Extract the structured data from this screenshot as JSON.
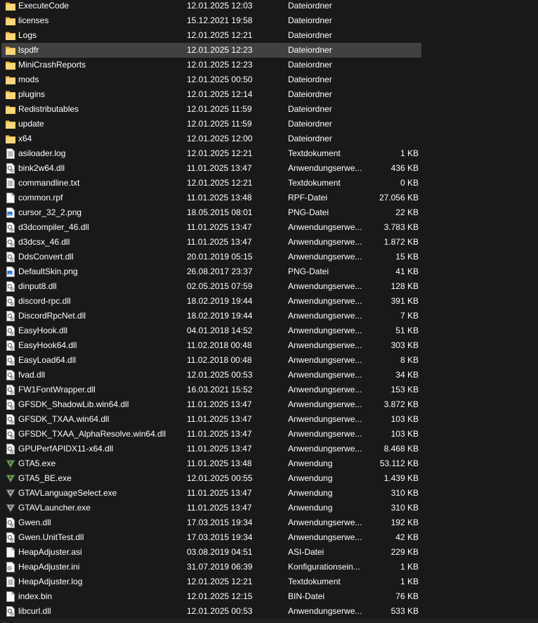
{
  "files": [
    {
      "name": "ExecuteCode",
      "date": "12.01.2025 12:03",
      "type": "Dateiordner",
      "size": "",
      "icon": "folder-icon"
    },
    {
      "name": "licenses",
      "date": "15.12.2021 19:58",
      "type": "Dateiordner",
      "size": "",
      "icon": "folder-icon"
    },
    {
      "name": "Logs",
      "date": "12.01.2025 12:21",
      "type": "Dateiordner",
      "size": "",
      "icon": "folder-icon"
    },
    {
      "name": "lspdfr",
      "date": "12.01.2025 12:23",
      "type": "Dateiordner",
      "size": "",
      "icon": "folder-icon",
      "selected": true
    },
    {
      "name": "MiniCrashReports",
      "date": "12.01.2025 12:23",
      "type": "Dateiordner",
      "size": "",
      "icon": "folder-icon"
    },
    {
      "name": "mods",
      "date": "12.01.2025 00:50",
      "type": "Dateiordner",
      "size": "",
      "icon": "folder-icon"
    },
    {
      "name": "plugins",
      "date": "12.01.2025 12:14",
      "type": "Dateiordner",
      "size": "",
      "icon": "folder-icon"
    },
    {
      "name": "Redistributables",
      "date": "12.01.2025 11:59",
      "type": "Dateiordner",
      "size": "",
      "icon": "folder-icon"
    },
    {
      "name": "update",
      "date": "12.01.2025 11:59",
      "type": "Dateiordner",
      "size": "",
      "icon": "folder-icon"
    },
    {
      "name": "x64",
      "date": "12.01.2025 12:00",
      "type": "Dateiordner",
      "size": "",
      "icon": "folder-icon"
    },
    {
      "name": "asiloader.log",
      "date": "12.01.2025 12:21",
      "type": "Textdokument",
      "size": "1 KB",
      "icon": "text-file-icon"
    },
    {
      "name": "bink2w64.dll",
      "date": "11.01.2025 13:47",
      "type": "Anwendungserwe...",
      "size": "436 KB",
      "icon": "dll-file-icon"
    },
    {
      "name": "commandline.txt",
      "date": "12.01.2025 12:21",
      "type": "Textdokument",
      "size": "0 KB",
      "icon": "text-file-icon"
    },
    {
      "name": "common.rpf",
      "date": "11.01.2025 13:48",
      "type": "RPF-Datei",
      "size": "27.056 KB",
      "icon": "blank-file-icon"
    },
    {
      "name": "cursor_32_2.png",
      "date": "18.05.2015 08:01",
      "type": "PNG-Datei",
      "size": "22 KB",
      "icon": "image-file-icon"
    },
    {
      "name": "d3dcompiler_46.dll",
      "date": "11.01.2025 13:47",
      "type": "Anwendungserwe...",
      "size": "3.783 KB",
      "icon": "dll-file-icon"
    },
    {
      "name": "d3dcsx_46.dll",
      "date": "11.01.2025 13:47",
      "type": "Anwendungserwe...",
      "size": "1.872 KB",
      "icon": "dll-file-icon"
    },
    {
      "name": "DdsConvert.dll",
      "date": "20.01.2019 05:15",
      "type": "Anwendungserwe...",
      "size": "15 KB",
      "icon": "dll-file-icon"
    },
    {
      "name": "DefaultSkin.png",
      "date": "26.08.2017 23:37",
      "type": "PNG-Datei",
      "size": "41 KB",
      "icon": "image-file-icon"
    },
    {
      "name": "dinput8.dll",
      "date": "02.05.2015 07:59",
      "type": "Anwendungserwe...",
      "size": "128 KB",
      "icon": "dll-file-icon"
    },
    {
      "name": "discord-rpc.dll",
      "date": "18.02.2019 19:44",
      "type": "Anwendungserwe...",
      "size": "391 KB",
      "icon": "dll-file-icon"
    },
    {
      "name": "DiscordRpcNet.dll",
      "date": "18.02.2019 19:44",
      "type": "Anwendungserwe...",
      "size": "7 KB",
      "icon": "dll-file-icon"
    },
    {
      "name": "EasyHook.dll",
      "date": "04.01.2018 14:52",
      "type": "Anwendungserwe...",
      "size": "51 KB",
      "icon": "dll-file-icon"
    },
    {
      "name": "EasyHook64.dll",
      "date": "11.02.2018 00:48",
      "type": "Anwendungserwe...",
      "size": "303 KB",
      "icon": "dll-file-icon"
    },
    {
      "name": "EasyLoad64.dll",
      "date": "11.02.2018 00:48",
      "type": "Anwendungserwe...",
      "size": "8 KB",
      "icon": "dll-file-icon"
    },
    {
      "name": "fvad.dll",
      "date": "12.01.2025 00:53",
      "type": "Anwendungserwe...",
      "size": "34 KB",
      "icon": "dll-file-icon"
    },
    {
      "name": "FW1FontWrapper.dll",
      "date": "16.03.2021 15:52",
      "type": "Anwendungserwe...",
      "size": "153 KB",
      "icon": "dll-file-icon"
    },
    {
      "name": "GFSDK_ShadowLib.win64.dll",
      "date": "11.01.2025 13:47",
      "type": "Anwendungserwe...",
      "size": "3.872 KB",
      "icon": "dll-file-icon"
    },
    {
      "name": "GFSDK_TXAA.win64.dll",
      "date": "11.01.2025 13:47",
      "type": "Anwendungserwe...",
      "size": "103 KB",
      "icon": "dll-file-icon"
    },
    {
      "name": "GFSDK_TXAA_AlphaResolve.win64.dll",
      "date": "11.01.2025 13:47",
      "type": "Anwendungserwe...",
      "size": "103 KB",
      "icon": "dll-file-icon"
    },
    {
      "name": "GPUPerfAPIDX11-x64.dll",
      "date": "11.01.2025 13:47",
      "type": "Anwendungserwe...",
      "size": "8.468 KB",
      "icon": "dll-file-icon"
    },
    {
      "name": "GTA5.exe",
      "date": "11.01.2025 13:48",
      "type": "Anwendung",
      "size": "53.112 KB",
      "icon": "gta-v-logo-icon"
    },
    {
      "name": "GTA5_BE.exe",
      "date": "12.01.2025 00:55",
      "type": "Anwendung",
      "size": "1.439 KB",
      "icon": "gta-v-logo-icon"
    },
    {
      "name": "GTAVLanguageSelect.exe",
      "date": "11.01.2025 13:47",
      "type": "Anwendung",
      "size": "310 KB",
      "icon": "gta-v-gray-logo-icon"
    },
    {
      "name": "GTAVLauncher.exe",
      "date": "11.01.2025 13:47",
      "type": "Anwendung",
      "size": "310 KB",
      "icon": "gta-v-gray-logo-icon"
    },
    {
      "name": "Gwen.dll",
      "date": "17.03.2015 19:34",
      "type": "Anwendungserwe...",
      "size": "192 KB",
      "icon": "dll-file-icon"
    },
    {
      "name": "Gwen.UnitTest.dll",
      "date": "17.03.2015 19:34",
      "type": "Anwendungserwe...",
      "size": "42 KB",
      "icon": "dll-file-icon"
    },
    {
      "name": "HeapAdjuster.asi",
      "date": "03.08.2019 04:51",
      "type": "ASI-Datei",
      "size": "229 KB",
      "icon": "blank-file-icon"
    },
    {
      "name": "HeapAdjuster.ini",
      "date": "31.07.2019 06:39",
      "type": "Konfigurationsein...",
      "size": "1 KB",
      "icon": "config-file-icon"
    },
    {
      "name": "HeapAdjuster.log",
      "date": "12.01.2025 12:21",
      "type": "Textdokument",
      "size": "1 KB",
      "icon": "text-file-icon"
    },
    {
      "name": "index.bin",
      "date": "12.01.2025 12:15",
      "type": "BIN-Datei",
      "size": "76 KB",
      "icon": "blank-file-icon"
    },
    {
      "name": "libcurl.dll",
      "date": "12.01.2025 00:53",
      "type": "Anwendungserwe...",
      "size": "533 KB",
      "icon": "dll-file-icon"
    }
  ]
}
